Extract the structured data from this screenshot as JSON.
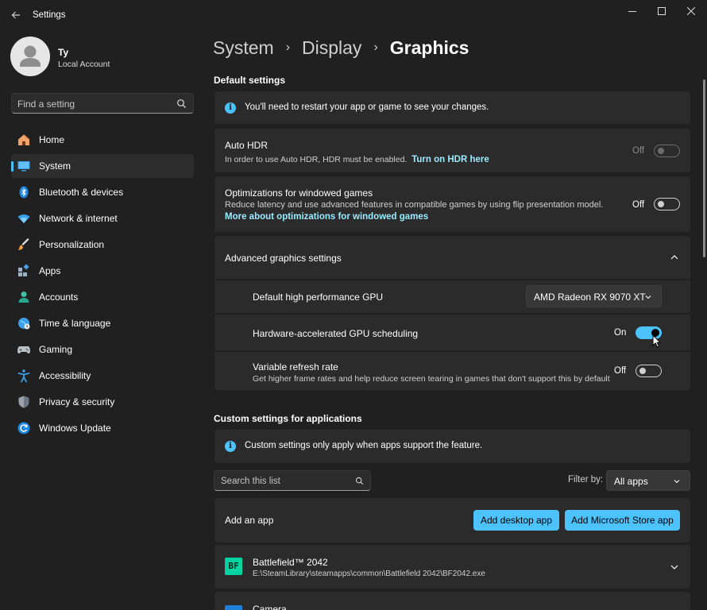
{
  "window": {
    "title": "Settings"
  },
  "profile": {
    "name": "Ty",
    "account_type": "Local Account"
  },
  "search": {
    "placeholder": "Find a setting"
  },
  "nav": {
    "items": [
      {
        "label": "Home",
        "icon": "home-icon"
      },
      {
        "label": "System",
        "icon": "system-icon"
      },
      {
        "label": "Bluetooth & devices",
        "icon": "bluetooth-icon"
      },
      {
        "label": "Network & internet",
        "icon": "network-icon"
      },
      {
        "label": "Personalization",
        "icon": "brush-icon"
      },
      {
        "label": "Apps",
        "icon": "apps-icon"
      },
      {
        "label": "Accounts",
        "icon": "accounts-icon"
      },
      {
        "label": "Time & language",
        "icon": "globe-icon"
      },
      {
        "label": "Gaming",
        "icon": "gamepad-icon"
      },
      {
        "label": "Accessibility",
        "icon": "accessibility-icon"
      },
      {
        "label": "Privacy & security",
        "icon": "shield-icon"
      },
      {
        "label": "Windows Update",
        "icon": "update-icon"
      }
    ],
    "active_index": 1
  },
  "breadcrumb": {
    "items": [
      "System",
      "Display",
      "Graphics"
    ]
  },
  "default_settings": {
    "heading": "Default settings",
    "info_text": "You'll need to restart your app or game to see your changes.",
    "auto_hdr": {
      "title": "Auto HDR",
      "description": "In order to use Auto HDR, HDR must be enabled.",
      "link": "Turn on HDR here",
      "state_label": "Off",
      "enabled": false
    },
    "windowed_games": {
      "title": "Optimizations for windowed games",
      "description": "Reduce latency and use advanced features in compatible games by using flip presentation model.",
      "link": "More about optimizations for windowed games",
      "state_label": "Off",
      "enabled": false
    },
    "advanced": {
      "title": "Advanced graphics settings",
      "expanded": true,
      "gpu": {
        "title": "Default high performance GPU",
        "selected": "AMD Radeon RX 9070 XT"
      },
      "hags": {
        "title": "Hardware-accelerated GPU scheduling",
        "state_label": "On",
        "enabled": true
      },
      "vrr": {
        "title": "Variable refresh rate",
        "description": "Get higher frame rates and help reduce screen tearing in games that don't support this by default",
        "state_label": "Off",
        "enabled": false
      }
    }
  },
  "custom_settings": {
    "heading": "Custom settings for applications",
    "info_text": "Custom settings only apply when apps support the feature.",
    "list_search_placeholder": "Search this list",
    "filter_label": "Filter by:",
    "filter_selected": "All apps",
    "add_app": {
      "label": "Add an app",
      "desktop_button": "Add desktop app",
      "store_button": "Add Microsoft Store app"
    },
    "apps": [
      {
        "name": "Battlefield™ 2042",
        "path": "E:\\SteamLibrary\\steamapps\\common\\Battlefield 2042\\BF2042.exe",
        "icon_text": "BF"
      },
      {
        "name": "Camera",
        "path": ""
      }
    ]
  },
  "colors": {
    "accent": "#4cc2ff",
    "link": "#99ebff",
    "background": "#202020",
    "card": "#2b2b2b"
  }
}
